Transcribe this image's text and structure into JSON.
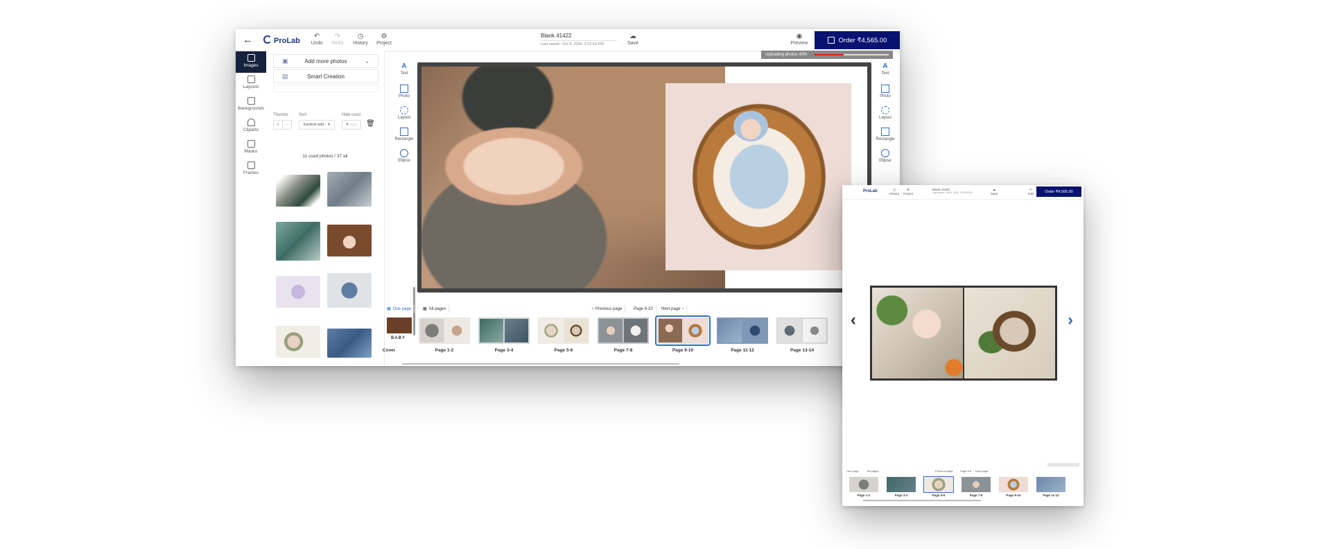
{
  "main": {
    "toolbar": {
      "back_icon": "←",
      "logo": "ProLab",
      "undo": "Undo",
      "redo": "Redo",
      "history": "History",
      "project": "Project",
      "title": "Blank 41422",
      "last_saved": "Last saved : Oct 9, 2024, 3:32:59 PM",
      "save": "Save",
      "preview": "Preview",
      "order": "Order ₹4,565.00"
    },
    "left_nav": [
      "Images",
      "Layouts",
      "Backgrounds",
      "Cliparts",
      "Masks",
      "Frames"
    ],
    "panel": {
      "add_more": "Add more photos",
      "smart": "Smart Creation",
      "thumbs_label": "Thumbs",
      "sort_label": "Sort",
      "hide_label": "Hide used",
      "sort_value": "Earliest add...",
      "count": "11 used photos / 37 all"
    },
    "tools": [
      "Text",
      "Photo",
      "Layout",
      "Rectangle",
      "Ellipse"
    ],
    "upload": "Uploading photos 40%",
    "upload_progress": 0.4,
    "page_bar": {
      "one_page": "One page",
      "all_pages": "All pages",
      "prev": "Previous page",
      "current": "Page 9-10",
      "next": "Next page"
    },
    "strip": [
      "Cover",
      "Page 1-2",
      "Page 3-4",
      "Page 5-6",
      "Page 7-8",
      "Page 9-10",
      "Page 11-12",
      "Page 13-14"
    ],
    "cover_text": "BABY"
  },
  "mini": {
    "logo": "ProLab",
    "history": "History",
    "project": "Project",
    "title": "Blank 41422",
    "last_saved": "Last saved : Oct 9, 2024, 3:32:59 PM",
    "save": "Save",
    "edit": "Edit",
    "order": "Order ₹4,565.00",
    "page_bar": {
      "one_page": "One page",
      "all_pages": "All pages",
      "prev": "Previous page",
      "current": "Page 5-6",
      "next": "Next page"
    },
    "strip": [
      "Page 1-2",
      "Page 3-4",
      "Page 5-6",
      "Page 7-8",
      "Page 9-10",
      "Page 11-12"
    ]
  },
  "colors": {
    "order_bg": "#08126f",
    "accent": "#2f6fc0",
    "nav_active": "#16213d"
  }
}
